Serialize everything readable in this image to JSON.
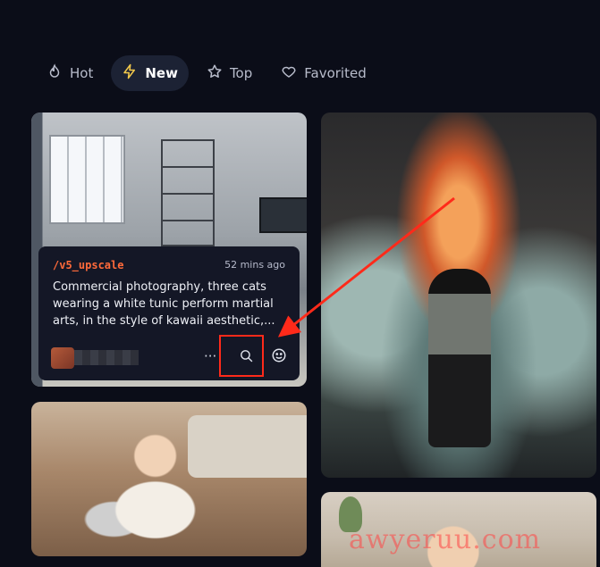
{
  "tabs": [
    {
      "label": "Hot",
      "icon": "flame-icon"
    },
    {
      "label": "New",
      "icon": "lightning-icon",
      "active": true
    },
    {
      "label": "Top",
      "icon": "star-icon"
    },
    {
      "label": "Favorited",
      "icon": "heart-icon"
    }
  ],
  "overlay": {
    "command": "/v5_upscale",
    "time": "52 mins ago",
    "prompt": "Commercial photography, three cats wearing a white tunic perform martial arts, in the style of kawaii aesthetic,...",
    "more_label": "···"
  },
  "colors": {
    "background": "#0b0d18",
    "active_tab": "#1c2234",
    "command": "#ff6a3a",
    "annotation": "#ff2a1a"
  },
  "watermark": "awyeruu.com"
}
